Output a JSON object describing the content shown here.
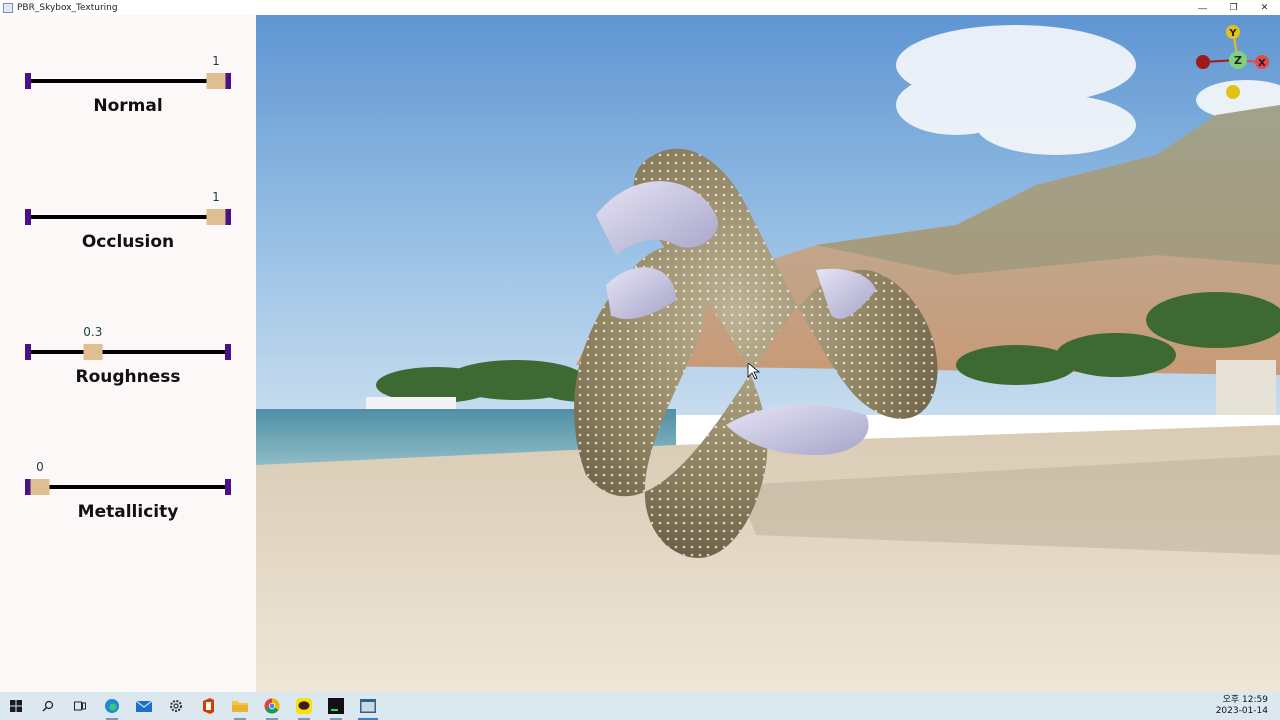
{
  "window": {
    "title": "PBR_Skybox_Texturing",
    "controls": [
      "—",
      "❐",
      "✕"
    ]
  },
  "sliders": [
    {
      "id": "normal",
      "label": "Normal",
      "value_text": "1",
      "value": 1
    },
    {
      "id": "occlusion",
      "label": "Occlusion",
      "value_text": "1",
      "value": 1
    },
    {
      "id": "roughness",
      "label": "Roughness",
      "value_text": "0.3",
      "value": 0.3
    },
    {
      "id": "metallicity",
      "label": "Metallicity",
      "value_text": "0",
      "value": 0
    }
  ],
  "gizmo": {
    "axes": [
      "Y",
      "Z",
      "X"
    ],
    "colors": {
      "y": "#e2c21a",
      "z": "#7ed27e",
      "x": "#e24a4a",
      "neg_x": "#a01818"
    }
  },
  "viewport": {
    "scene": "beach-skybox",
    "model": "trefoil-knot"
  },
  "taskbar": {
    "icons": [
      "windows-start-icon",
      "search-icon",
      "task-view-icon",
      "edge-icon",
      "mail-icon",
      "settings-icon",
      "office-icon",
      "file-explorer-icon",
      "chrome-icon",
      "kakaotalk-icon",
      "terminal-icon",
      "app-window-icon"
    ],
    "clock_time": "오후 12:59",
    "clock_date": "2023-01-14"
  }
}
